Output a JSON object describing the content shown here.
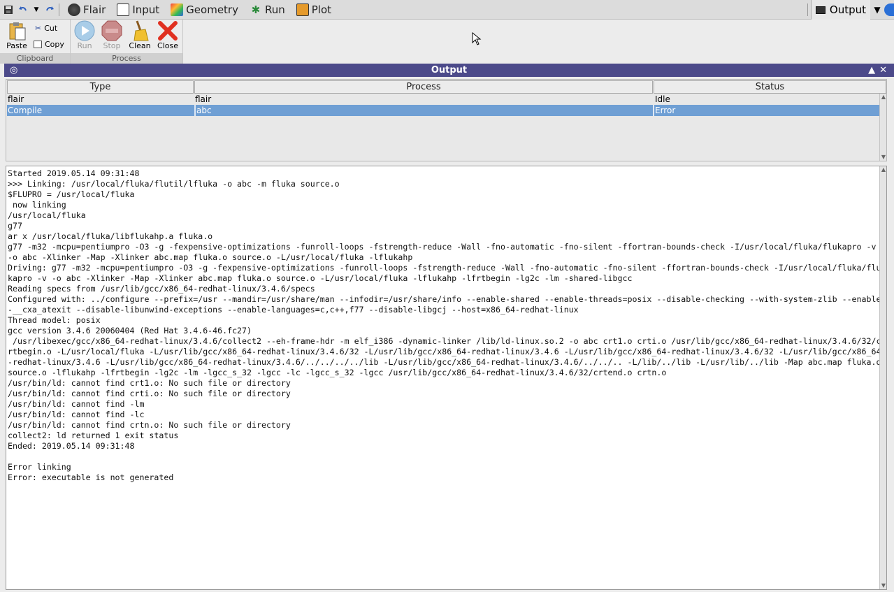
{
  "menubar": {
    "tabs": [
      {
        "label": "Flair",
        "icon": "flair-icon"
      },
      {
        "label": "Input",
        "icon": "input-icon"
      },
      {
        "label": "Geometry",
        "icon": "geometry-icon"
      },
      {
        "label": "Run",
        "icon": "run-icon"
      },
      {
        "label": "Plot",
        "icon": "plot-icon"
      }
    ],
    "active_panel": "Output"
  },
  "ribbon": {
    "clipboard": {
      "label": "Clipboard",
      "paste": "Paste",
      "cut": "Cut",
      "copy": "Copy"
    },
    "process": {
      "label": "Process",
      "run": "Run",
      "stop": "Stop",
      "clean": "Clean",
      "close": "Close"
    }
  },
  "panel": {
    "title": "Output",
    "columns": [
      "Type",
      "Process",
      "Status"
    ],
    "rows": [
      {
        "type": "flair",
        "process": "flair",
        "status": "Idle",
        "selected": false
      },
      {
        "type": "Compile",
        "process": "abc",
        "status": "Error",
        "selected": true
      }
    ]
  },
  "log": "Started 2019.05.14 09:31:48\n>>> Linking: /usr/local/fluka/flutil/lfluka -o abc -m fluka source.o\n$FLUPRO = /usr/local/fluka\n now linking\n/usr/local/fluka\ng77\nar x /usr/local/fluka/libflukahp.a fluka.o\ng77 -m32 -mcpu=pentiumpro -O3 -g -fexpensive-optimizations -funroll-loops -fstrength-reduce -Wall -fno-automatic -fno-silent -ffortran-bounds-check -I/usr/local/fluka/flukapro -v -o abc -Xlinker -Map -Xlinker abc.map fluka.o source.o -L/usr/local/fluka -lflukahp\nDriving: g77 -m32 -mcpu=pentiumpro -O3 -g -fexpensive-optimizations -funroll-loops -fstrength-reduce -Wall -fno-automatic -fno-silent -ffortran-bounds-check -I/usr/local/fluka/flukapro -v -o abc -Xlinker -Map -Xlinker abc.map fluka.o source.o -L/usr/local/fluka -lflukahp -lfrtbegin -lg2c -lm -shared-libgcc\nReading specs from /usr/lib/gcc/x86_64-redhat-linux/3.4.6/specs\nConfigured with: ../configure --prefix=/usr --mandir=/usr/share/man --infodir=/usr/share/info --enable-shared --enable-threads=posix --disable-checking --with-system-zlib --enable-__cxa_atexit --disable-libunwind-exceptions --enable-languages=c,c++,f77 --disable-libgcj --host=x86_64-redhat-linux\nThread model: posix\ngcc version 3.4.6 20060404 (Red Hat 3.4.6-46.fc27)\n /usr/libexec/gcc/x86_64-redhat-linux/3.4.6/collect2 --eh-frame-hdr -m elf_i386 -dynamic-linker /lib/ld-linux.so.2 -o abc crt1.o crti.o /usr/lib/gcc/x86_64-redhat-linux/3.4.6/32/crtbegin.o -L/usr/local/fluka -L/usr/lib/gcc/x86_64-redhat-linux/3.4.6/32 -L/usr/lib/gcc/x86_64-redhat-linux/3.4.6 -L/usr/lib/gcc/x86_64-redhat-linux/3.4.6/32 -L/usr/lib/gcc/x86_64-redhat-linux/3.4.6 -L/usr/lib/gcc/x86_64-redhat-linux/3.4.6/../../../../lib -L/usr/lib/gcc/x86_64-redhat-linux/3.4.6/../../.. -L/lib/../lib -L/usr/lib/../lib -Map abc.map fluka.o source.o -lflukahp -lfrtbegin -lg2c -lm -lgcc_s_32 -lgcc -lc -lgcc_s_32 -lgcc /usr/lib/gcc/x86_64-redhat-linux/3.4.6/32/crtend.o crtn.o\n/usr/bin/ld: cannot find crt1.o: No such file or directory\n/usr/bin/ld: cannot find crti.o: No such file or directory\n/usr/bin/ld: cannot find -lm\n/usr/bin/ld: cannot find -lc\n/usr/bin/ld: cannot find crtn.o: No such file or directory\ncollect2: ld returned 1 exit status\nEnded: 2019.05.14 09:31:48\n\nError linking\nError: executable is not generated"
}
